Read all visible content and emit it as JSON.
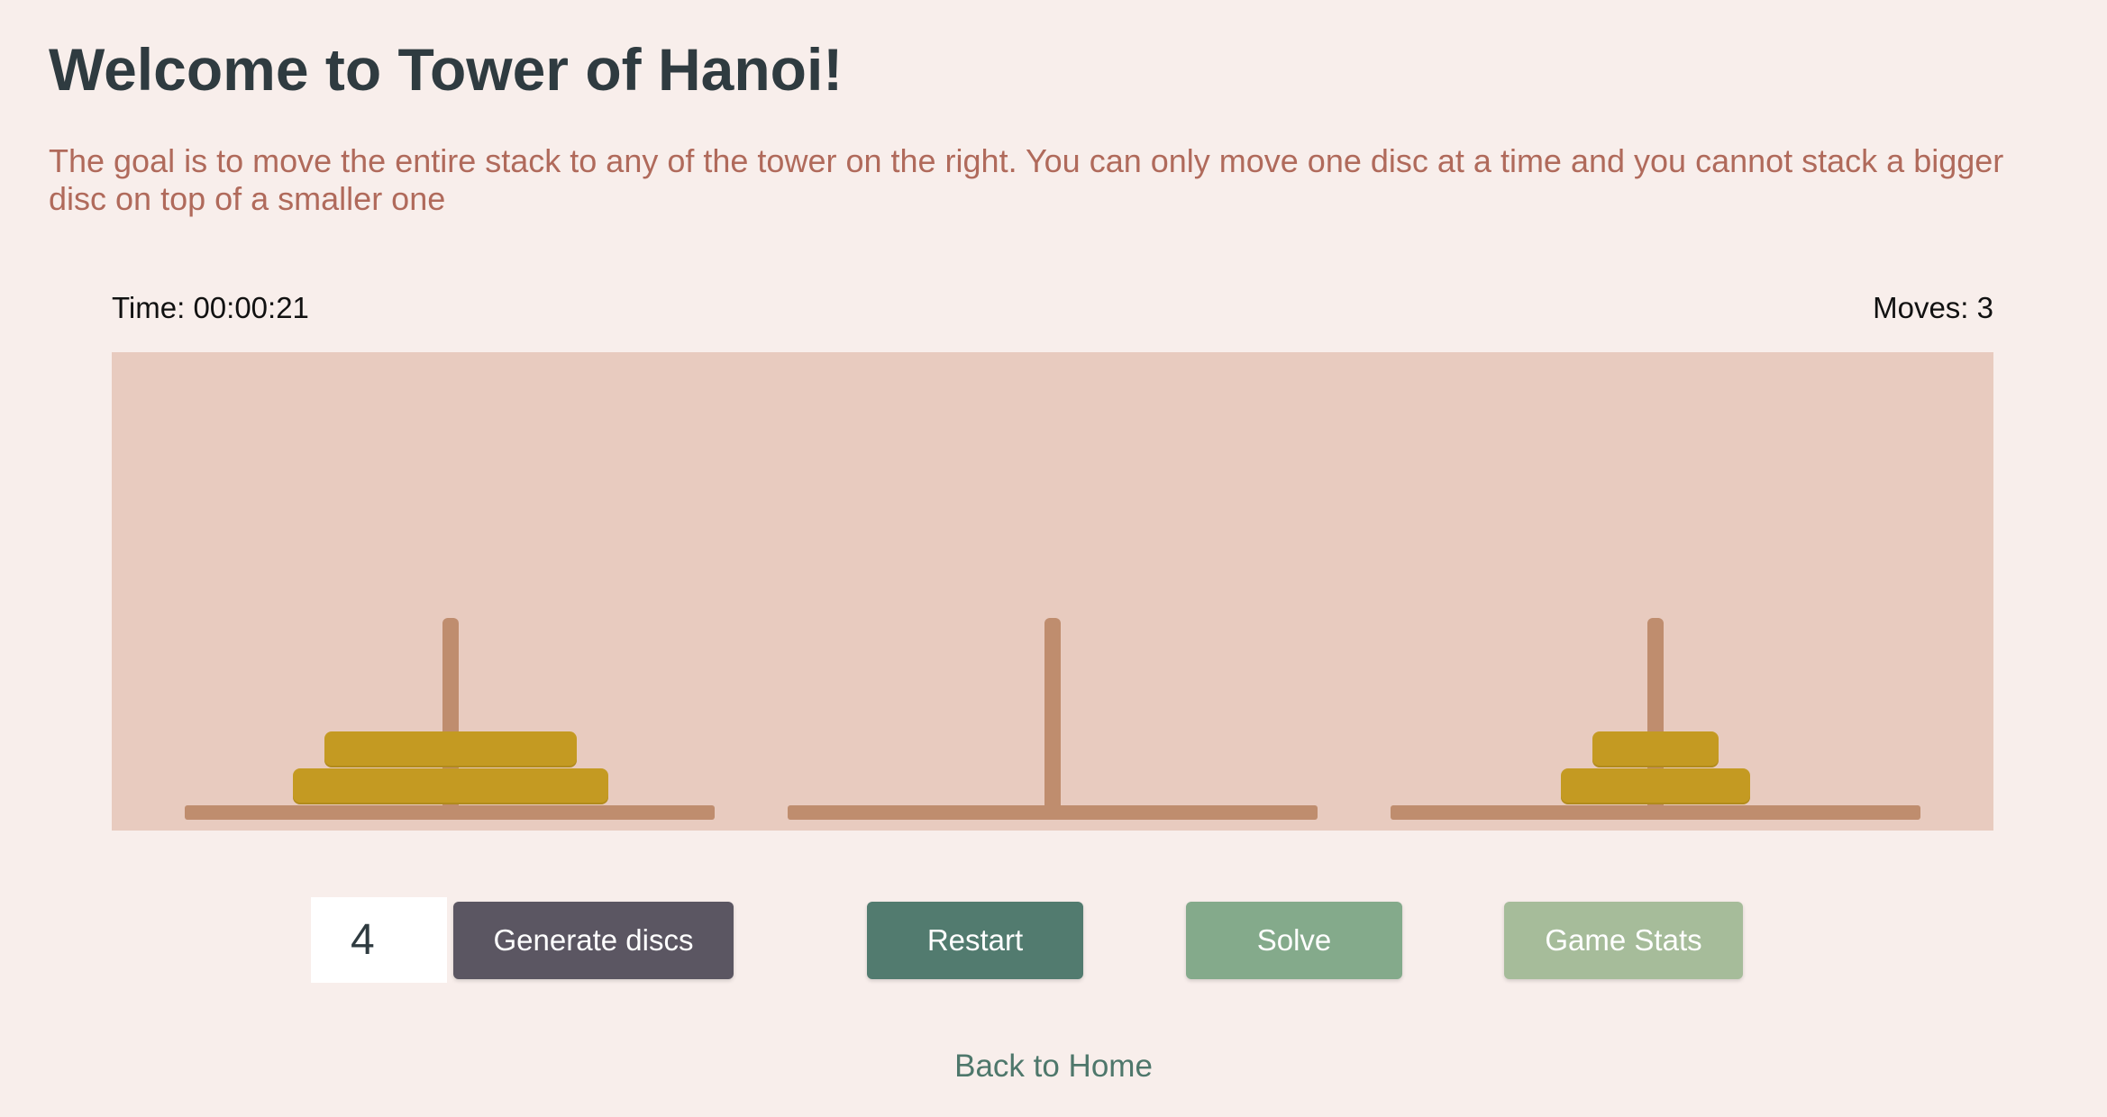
{
  "header": {
    "title": "Welcome to Tower of Hanoi!",
    "description": "The goal is to move the entire stack to any of the tower on the right. You can only move one disc at a time and you cannot stack a bigger disc on top of a smaller one"
  },
  "status": {
    "time": "Time: 00:00:21",
    "moves": "Moves: 3"
  },
  "game": {
    "total_discs": 4,
    "towers": [
      {
        "name": "left",
        "disc_sizes_bottom_to_top": [
          4,
          3
        ]
      },
      {
        "name": "middle",
        "disc_sizes_bottom_to_top": []
      },
      {
        "name": "right",
        "disc_sizes_bottom_to_top": [
          2,
          1
        ]
      }
    ],
    "colors": {
      "board": "#e8cbbf",
      "peg": "#bf8d6e",
      "disc": "#c49a22"
    }
  },
  "controls": {
    "disc_count_value": "4",
    "generate_label": "Generate discs",
    "restart_label": "Restart",
    "solve_label": "Solve",
    "stats_label": "Game Stats"
  },
  "footer": {
    "home_link": "Back to Home"
  }
}
